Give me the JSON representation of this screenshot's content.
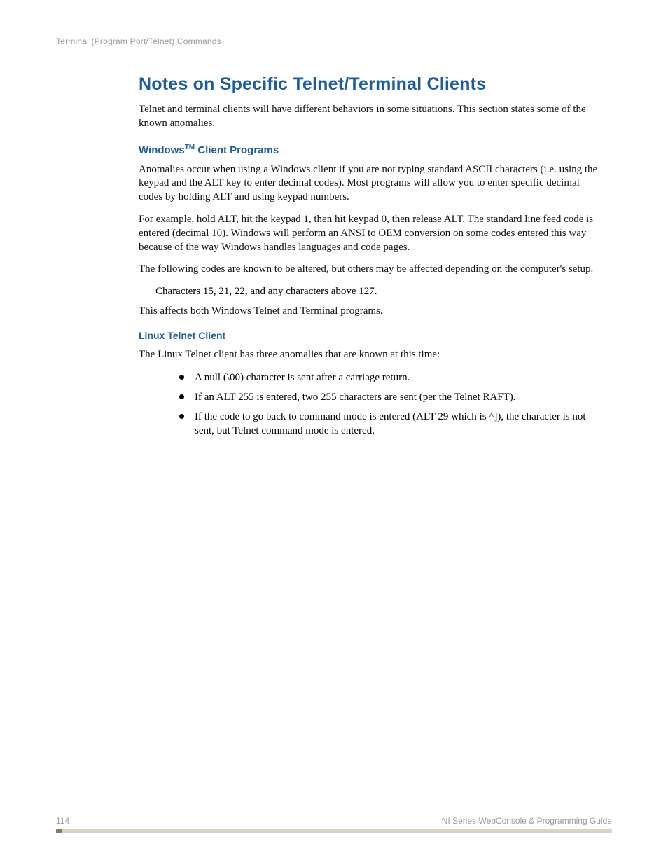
{
  "header": {
    "running_title": "Terminal (Program Port/Telnet) Commands"
  },
  "section": {
    "title": "Notes on Specific Telnet/Terminal Clients",
    "intro": "Telnet and terminal clients will have different behaviors in some situations. This section states some of the known anomalies.",
    "windows": {
      "heading_prefix": "Windows",
      "heading_sup": "TM",
      "heading_suffix": " Client Programs",
      "p1": "Anomalies occur when using a Windows client if you are not typing standard ASCII characters (i.e. using the keypad and the ALT key to enter decimal codes). Most programs will allow you to enter specific decimal codes by holding ALT and using keypad numbers.",
      "p2": "For example, hold ALT, hit the keypad 1, then hit keypad 0, then release ALT. The standard line feed code is entered (decimal 10). Windows will perform an ANSI to OEM conversion on some codes entered this way because of the way Windows handles languages and code pages.",
      "p3": "The following codes are known to be altered, but others may be affected depending on the computer's setup.",
      "indent": "Characters 15, 21, 22, and any characters above 127.",
      "p4": "This affects both Windows Telnet and Terminal programs."
    },
    "linux": {
      "heading": "Linux Telnet Client",
      "intro": "The Linux Telnet client has three anomalies that are known at this time:",
      "bullets": [
        "A null (\\00) character is sent after a carriage return.",
        "If an ALT 255 is entered, two 255 characters are sent (per the Telnet RAFT).",
        "If the code to go back to command mode is entered (ALT 29 which is ^]), the character is not sent, but Telnet command mode is entered."
      ]
    }
  },
  "footer": {
    "page_number": "114",
    "doc_title": "NI Series WebConsole & Programming Guide"
  }
}
